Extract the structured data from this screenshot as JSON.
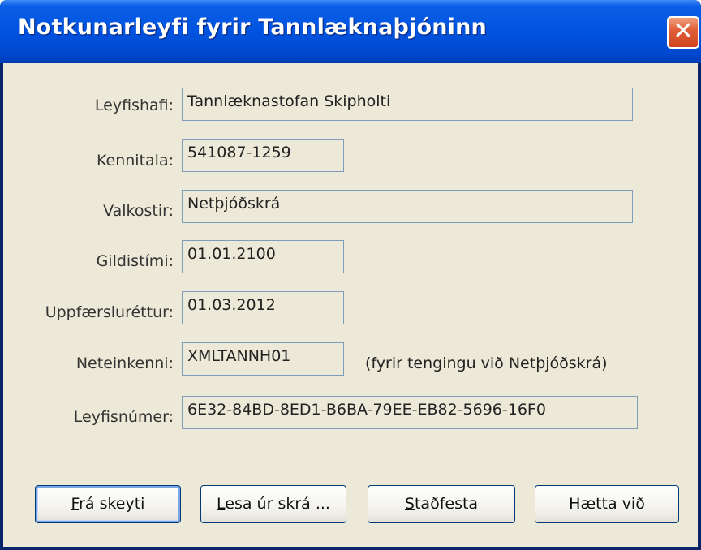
{
  "window": {
    "title": "Notkunarleyfi fyrir Tannlæknaþjóninn",
    "close_glyph": "✕"
  },
  "fields": {
    "licensee": {
      "label": "Leyfishafi:",
      "value": "Tannlæknastofan Skipholti"
    },
    "ssn": {
      "label": "Kennitala:",
      "value": "541087-1259"
    },
    "options": {
      "label": "Valkostir:",
      "value": "Netþjóðskrá"
    },
    "validity": {
      "label": "Gildistími:",
      "value": "01.01.2100"
    },
    "update_rights": {
      "label": "Uppfærsluréttur:",
      "value": "01.03.2012"
    },
    "net_id": {
      "label": "Neteinkenni:",
      "value": "XMLTANNH01",
      "hint": "(fyrir tengingu við Netþjóðskrá)"
    },
    "license_number": {
      "label": "Leyfisnúmer:",
      "value": "6E32-84BD-8ED1-B6BA-79EE-EB82-5696-16F0"
    }
  },
  "buttons": {
    "from_email": {
      "mnemonic": "F",
      "rest": "rá skeyti"
    },
    "read_file": {
      "mnemonic": "L",
      "rest": "esa úr skrá ..."
    },
    "confirm": {
      "mnemonic": "S",
      "rest": "taðfesta"
    },
    "cancel": {
      "label": "Hætta við"
    }
  },
  "colors": {
    "titlebar": "#0053e0",
    "client_bg": "#ece9d8",
    "field_border": "#7f9db9",
    "close_button": "#e0603a"
  }
}
